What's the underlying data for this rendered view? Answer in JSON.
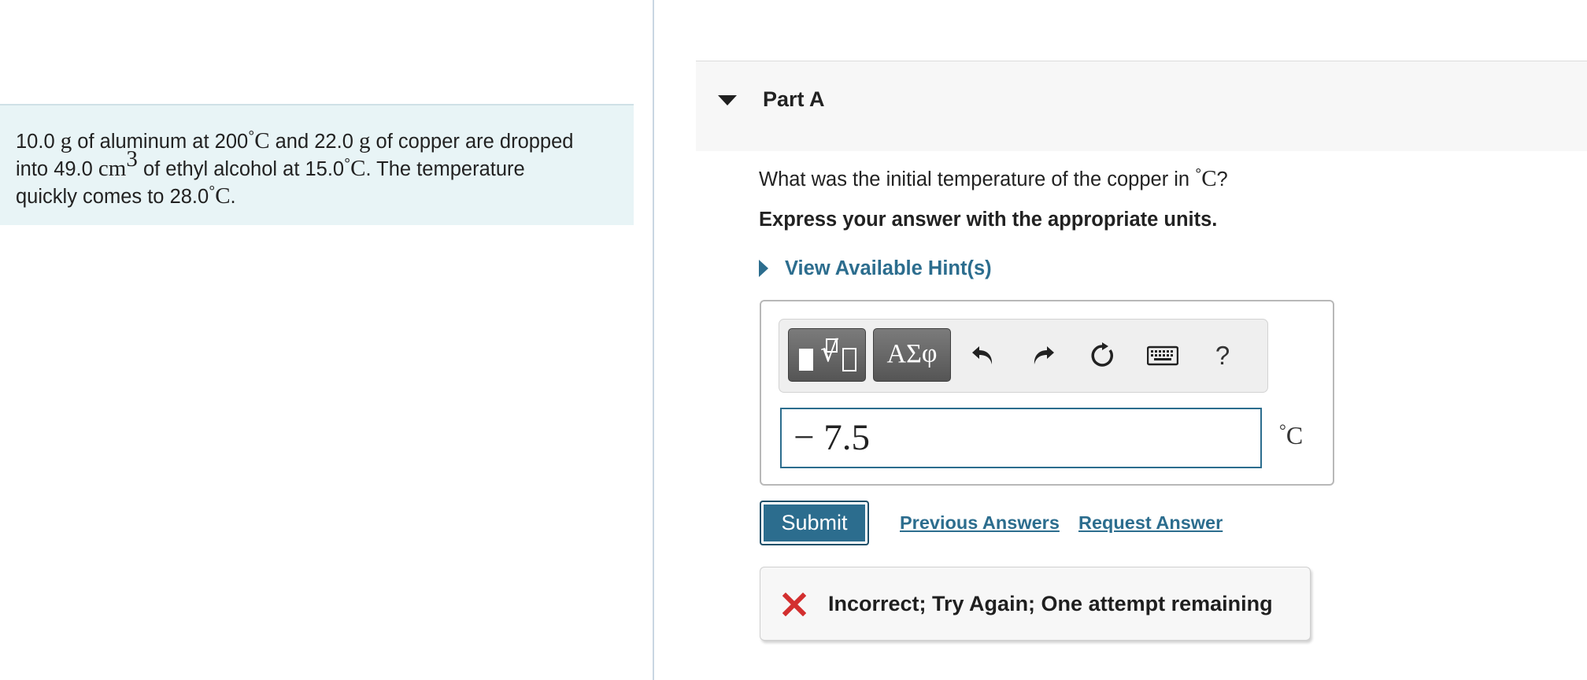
{
  "problem": {
    "line1": {
      "t1": "10.0 ",
      "u1": "g",
      "t2": " of aluminum at 200",
      "deg": "°",
      "u2": "C",
      "t3": " and 22.0 ",
      "u3": "g",
      "t4": " of copper are dropped"
    },
    "line2": {
      "t1": "into 49.0 ",
      "u1": "cm",
      "sup": "3",
      "t2": " of ethyl alcohol at 15.0",
      "deg": "°",
      "u2": "C",
      "t3": ". The temperature"
    },
    "line3": {
      "t1": "quickly comes to 28.0",
      "deg": "°",
      "u2": "C",
      "t3": "."
    }
  },
  "part": {
    "title": "Part A"
  },
  "question": {
    "text": "What was the initial temperature of the copper in ",
    "deg": "°",
    "unit": "C",
    "end": "?"
  },
  "instruction": "Express your answer with the appropriate units.",
  "hint": {
    "label": "View Available Hint(s)"
  },
  "toolbar": {
    "greek_label": "ΑΣφ",
    "help_label": "?",
    "icons": [
      "templates-icon",
      "undo-icon",
      "redo-icon",
      "reset-icon",
      "keyboard-icon",
      "help-icon"
    ]
  },
  "answer": {
    "value": "− 7.5",
    "unit_deg": "°",
    "unit": "C"
  },
  "actions": {
    "submit": "Submit",
    "previous": "Previous Answers",
    "request": "Request Answer"
  },
  "feedback": {
    "text": "Incorrect; Try Again; One attempt remaining",
    "color": "#d32f2f"
  },
  "colors": {
    "accent": "#2c6d8e",
    "problem_bg": "#e8f4f6",
    "header_bg": "#f7f7f7"
  }
}
